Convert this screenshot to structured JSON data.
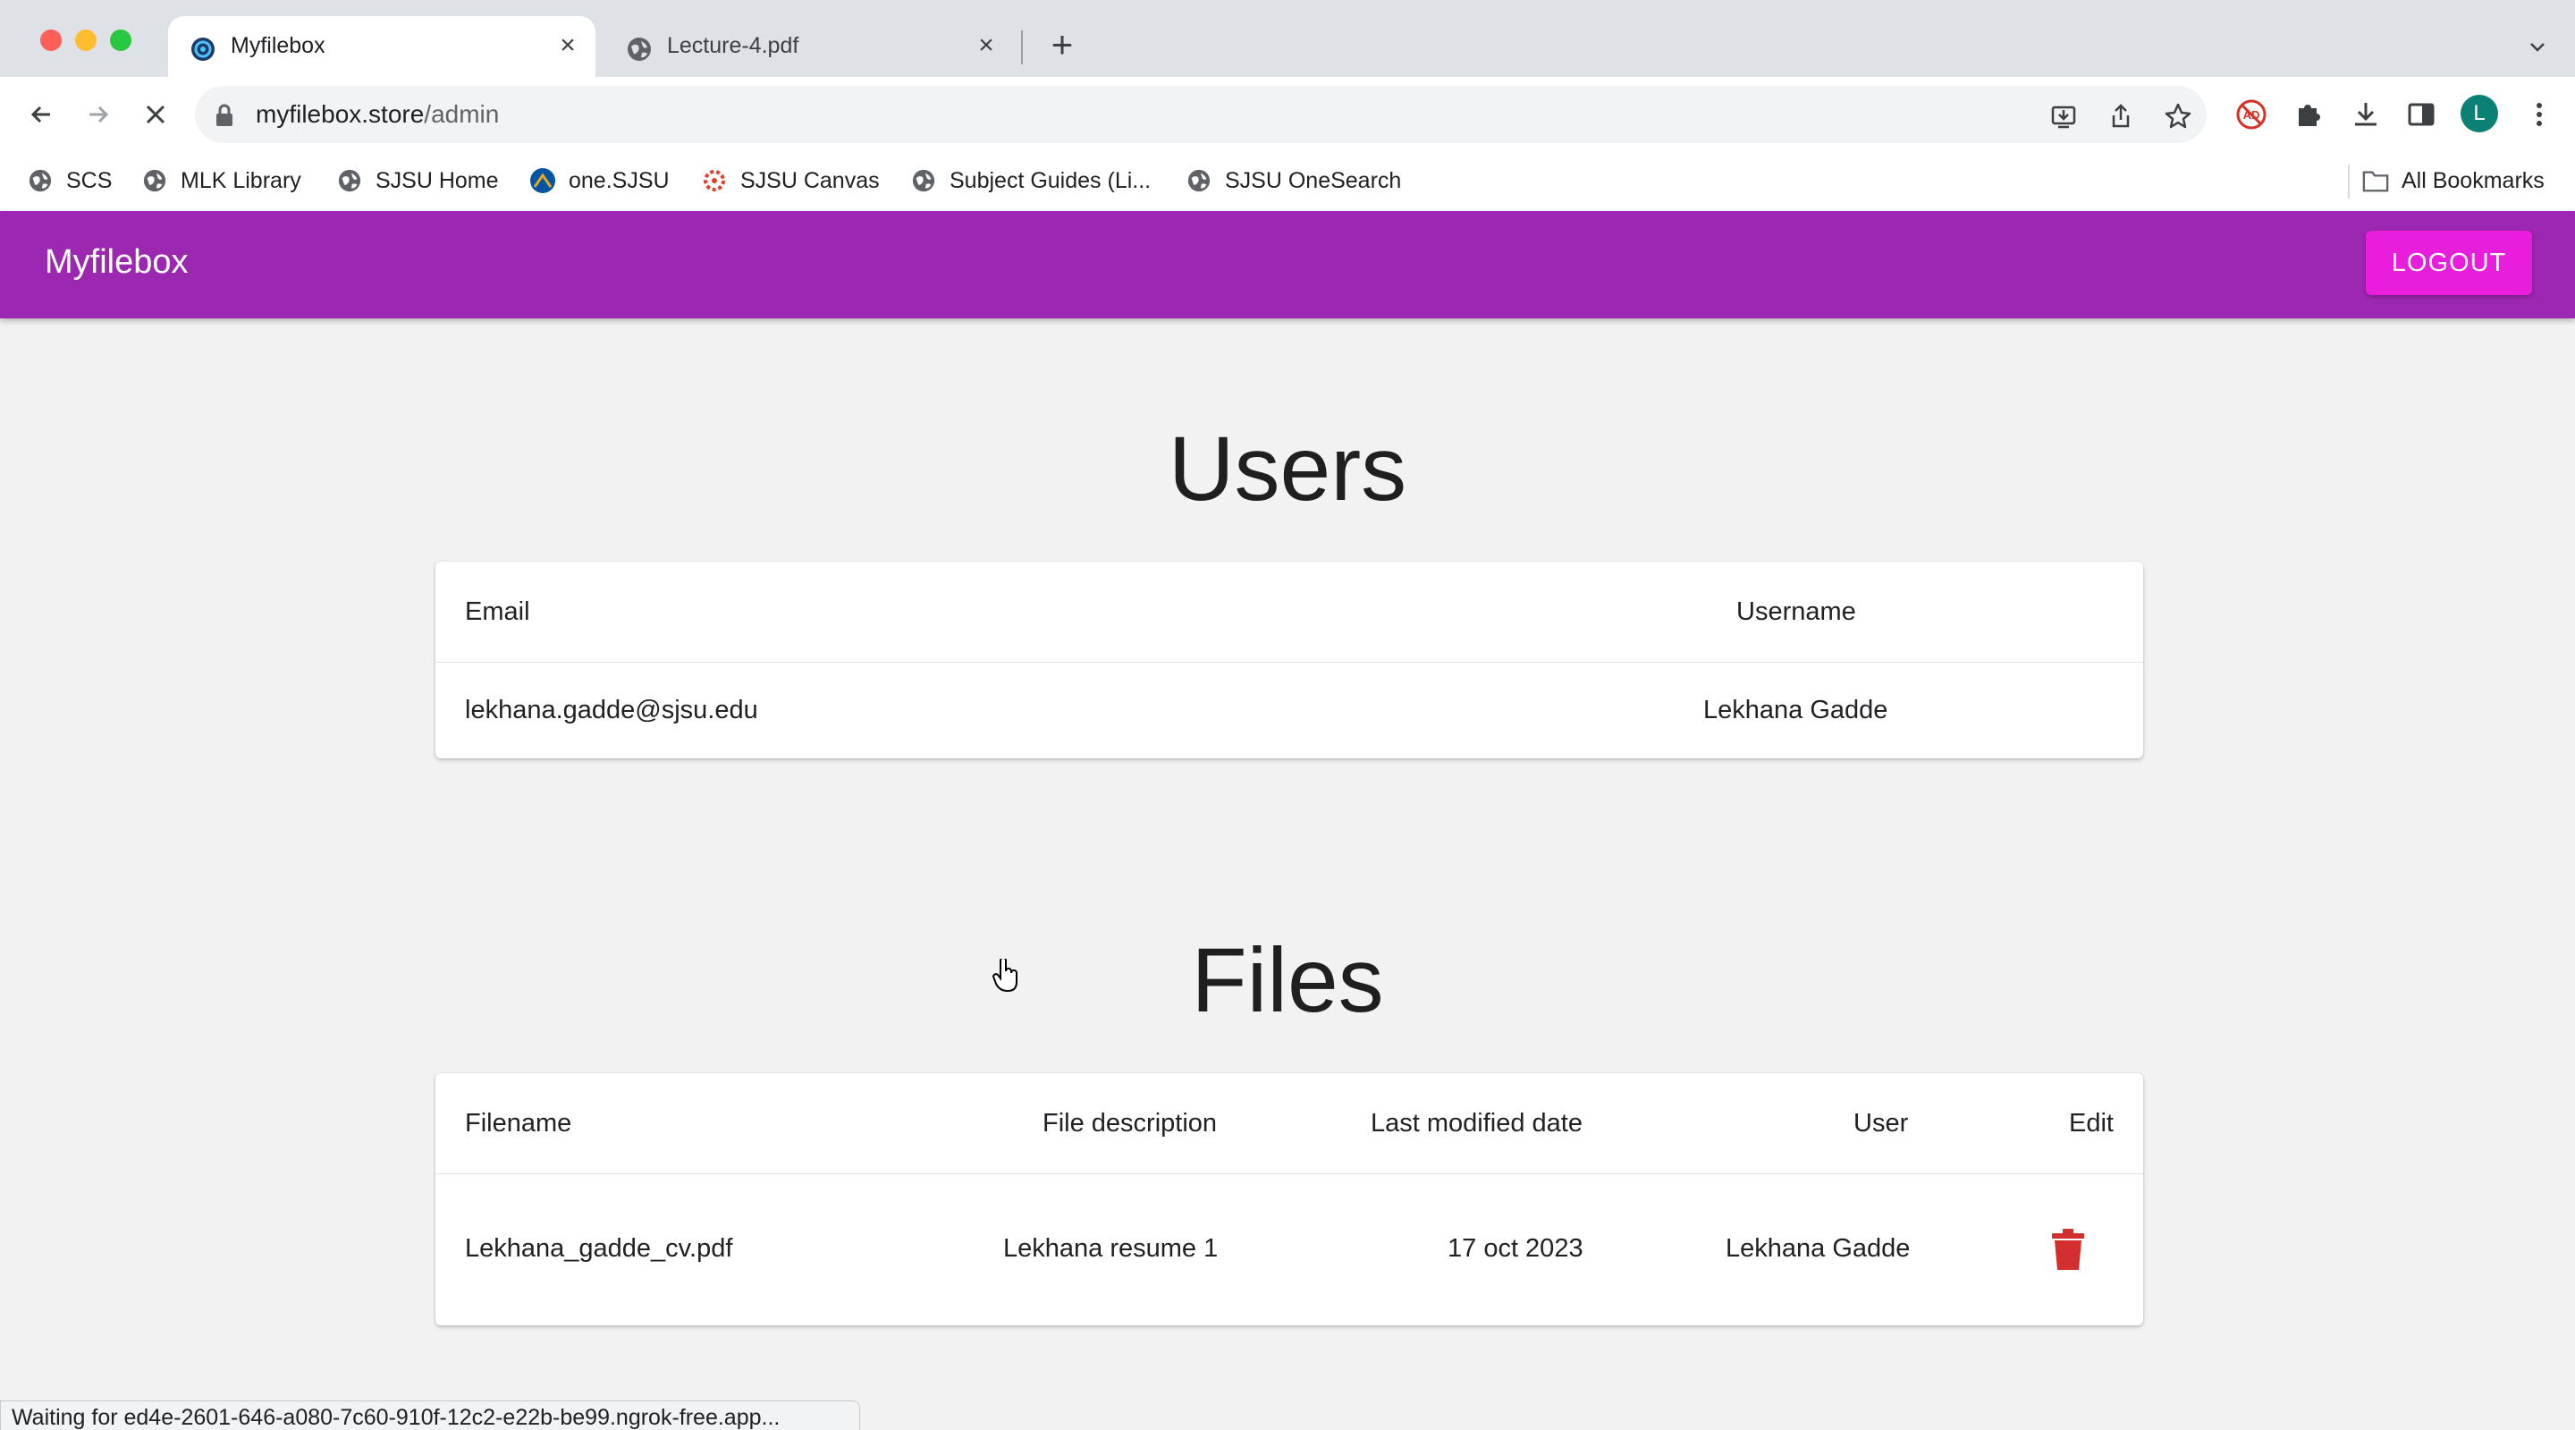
{
  "browser": {
    "tabs": [
      {
        "title": "Myfilebox",
        "active": true
      },
      {
        "title": "Lecture-4.pdf",
        "active": false
      }
    ],
    "url": {
      "host": "myfilebox.store",
      "path": "/admin"
    },
    "profile_initial": "L",
    "bookmarks": [
      {
        "label": "SCS",
        "icon": "globe-icon"
      },
      {
        "label": "MLK Library",
        "icon": "globe-icon"
      },
      {
        "label": "SJSU Home",
        "icon": "globe-icon"
      },
      {
        "label": "one.SJSU",
        "icon": "onesjsu-icon"
      },
      {
        "label": "SJSU Canvas",
        "icon": "canvas-icon"
      },
      {
        "label": "Subject Guides (Li...",
        "icon": "globe-icon"
      },
      {
        "label": "SJSU OneSearch",
        "icon": "globe-icon"
      }
    ],
    "all_bookmarks_label": "All Bookmarks",
    "status_text": "Waiting for ed4e-2601-646-a080-7c60-910f-12c2-e22b-be99.ngrok-free.app..."
  },
  "app": {
    "brand": "Myfilebox",
    "logout_label": "LOGOUT",
    "accent_color": "#9c27b0",
    "logout_color": "#e91edd"
  },
  "users": {
    "title": "Users",
    "columns": [
      "Email",
      "Username"
    ],
    "rows": [
      {
        "email": "lekhana.gadde@sjsu.edu",
        "username": "Lekhana Gadde"
      }
    ]
  },
  "files": {
    "title": "Files",
    "columns": [
      "Filename",
      "File description",
      "Last modified date",
      "User",
      "Edit"
    ],
    "rows": [
      {
        "filename": "Lekhana_gadde_cv.pdf",
        "description": "Lekhana resume 1",
        "modified": "17 oct 2023",
        "user": "Lekhana Gadde",
        "action_icon": "trash-icon",
        "action_color": "#d32f2f"
      }
    ]
  }
}
